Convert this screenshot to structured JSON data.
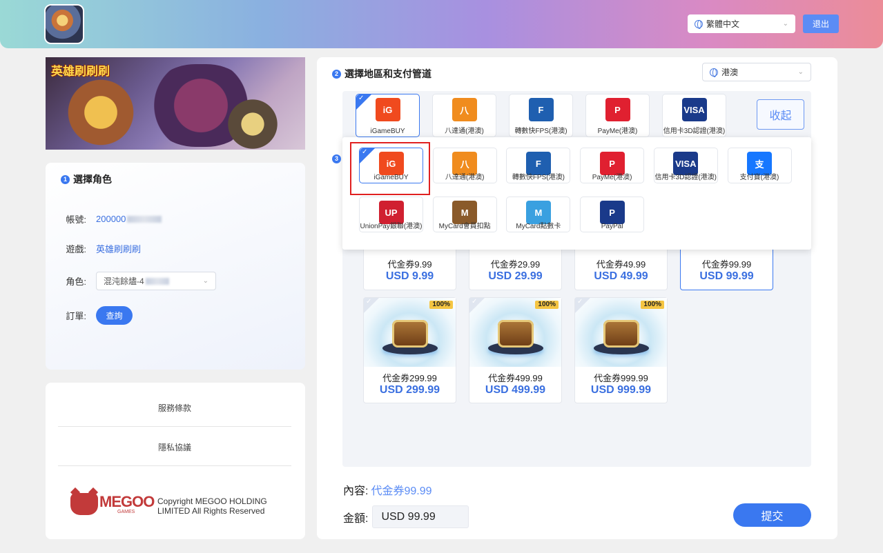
{
  "header": {
    "language": "繁體中文",
    "logout_label": "退出"
  },
  "banner": {
    "game_title": "英雄刷刷刷"
  },
  "role_section": {
    "step": "1",
    "title": "選擇角色",
    "account_label": "帳號:",
    "account_value": "200000",
    "game_label": "遊戲:",
    "game_value": "英雄刷刷刷",
    "role_label": "角色:",
    "role_value": "混沌餘燼-4",
    "order_label": "訂單:",
    "query_label": "查詢"
  },
  "links": {
    "terms": "服務條款",
    "privacy": "隱私協議",
    "brand": "MEGOO",
    "brand_sub": "GAMES",
    "copyright": "Copyright MEGOO HOLDING LIMITED All Rights Reserved"
  },
  "payment_section": {
    "step": "2",
    "title": "選擇地區和支付管道",
    "region": "港澳",
    "collapse_label": "收起",
    "top_row": [
      {
        "name": "iGameBUY",
        "logo": "iG",
        "color": "#f04a1e",
        "selected": true
      },
      {
        "name": "八達通(港澳)",
        "logo": "八",
        "color": "#f08c1e",
        "selected": false
      },
      {
        "name": "轉數快FPS(港澳)",
        "logo": "F",
        "color": "#1f5fb0",
        "selected": false
      },
      {
        "name": "PayMe(港澳)",
        "logo": "P",
        "color": "#e02030",
        "selected": false
      },
      {
        "name": "信用卡3D認證(港澳)",
        "logo": "VISA",
        "color": "#1a3a8a",
        "selected": false
      }
    ],
    "step3": "3",
    "dropdown_row1": [
      {
        "name": "iGameBUY",
        "logo": "iG",
        "color": "#f04a1e",
        "selected": true
      },
      {
        "name": "八達通(港澳)",
        "logo": "八",
        "color": "#f08c1e",
        "selected": false
      },
      {
        "name": "轉數快FPS(港澳)",
        "logo": "F",
        "color": "#1f5fb0",
        "selected": false
      },
      {
        "name": "PayMe(港澳)",
        "logo": "P",
        "color": "#e02030",
        "selected": false
      },
      {
        "name": "信用卡3D認證(港澳)",
        "logo": "VISA",
        "color": "#1a3a8a",
        "selected": false
      },
      {
        "name": "支付寶(港澳)",
        "logo": "支",
        "color": "#1677ff",
        "selected": false
      }
    ],
    "dropdown_row2": [
      {
        "name": "UnionPay銀聯(港澳)",
        "logo": "UP",
        "color": "#d02030",
        "selected": false
      },
      {
        "name": "MyCard會員扣點",
        "logo": "M",
        "color": "#8a5a2a",
        "selected": false
      },
      {
        "name": "MyCard點數卡",
        "logo": "M",
        "color": "#3aa0e0",
        "selected": false
      },
      {
        "name": "PayPal",
        "logo": "P",
        "color": "#1a3a8a",
        "selected": false
      }
    ]
  },
  "products_row1": [
    {
      "name": "代金券9.99",
      "price": "USD 9.99",
      "selected": false
    },
    {
      "name": "代金券29.99",
      "price": "USD 29.99",
      "selected": false
    },
    {
      "name": "代金券49.99",
      "price": "USD 49.99",
      "selected": false
    },
    {
      "name": "代金券99.99",
      "price": "USD 99.99",
      "selected": true
    }
  ],
  "products_row2": [
    {
      "name": "代金券299.99",
      "price": "USD 299.99",
      "badge": "100%"
    },
    {
      "name": "代金券499.99",
      "price": "USD 499.99",
      "badge": "100%"
    },
    {
      "name": "代金券999.99",
      "price": "USD 999.99",
      "badge": "100%"
    }
  ],
  "summary": {
    "content_label": "內容:",
    "content_value": "代金券99.99",
    "amount_label": "金額:",
    "amount_value": "USD 99.99",
    "submit_label": "提交"
  }
}
